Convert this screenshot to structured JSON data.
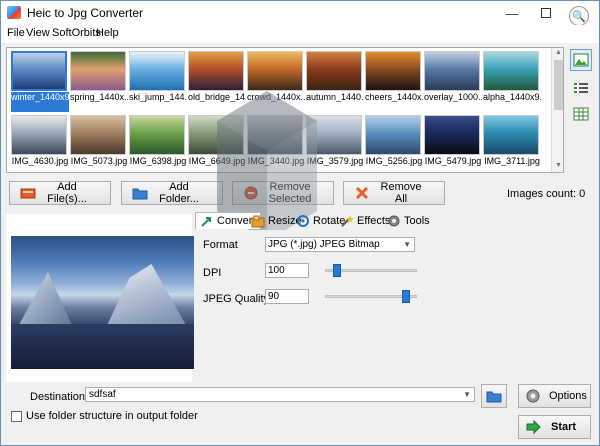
{
  "window": {
    "title": "Heic to Jpg Converter"
  },
  "menu": [
    "File",
    "View",
    "SoftOrbits",
    "Help"
  ],
  "thumbnails": [
    {
      "label": "winter_1440x960.heic",
      "selected": true,
      "colors": [
        "#1c3f78",
        "#5f8bc3",
        "#bcd0e6"
      ]
    },
    {
      "label": "spring_1440x...",
      "selected": false,
      "colors": [
        "#8d5a8e",
        "#e0a06a",
        "#3d6b3a"
      ]
    },
    {
      "label": "ski_jump_144...",
      "selected": false,
      "colors": [
        "#1d6fb3",
        "#6ab0e0",
        "#e8f2fa"
      ]
    },
    {
      "label": "old_bridge_14...",
      "selected": false,
      "colors": [
        "#2c1f3a",
        "#b24e2b",
        "#e0a040"
      ]
    },
    {
      "label": "crowd_1440x...",
      "selected": false,
      "colors": [
        "#3a2a1c",
        "#c06a28",
        "#f0b860"
      ]
    },
    {
      "label": "autumn_1440...",
      "selected": false,
      "colors": [
        "#3d2415",
        "#8a3a1c",
        "#d08040"
      ]
    },
    {
      "label": "cheers_1440x...",
      "selected": false,
      "colors": [
        "#1a1410",
        "#8a4a22",
        "#e0902a"
      ]
    },
    {
      "label": "overlay_1000...",
      "selected": false,
      "colors": [
        "#2a3a5a",
        "#5a7aa8",
        "#c0d0e0"
      ]
    },
    {
      "label": "alpha_1440x9...",
      "selected": false,
      "colors": [
        "#1f5a38",
        "#3aa0b8",
        "#a8d8e0"
      ]
    },
    {
      "label": "IMG_4630.jpg",
      "selected": false,
      "colors": [
        "#3a4a5a",
        "#9aa8b8",
        "#e8e8e8"
      ]
    },
    {
      "label": "IMG_5073.jpg",
      "selected": false,
      "colors": [
        "#4a3a2a",
        "#a08060",
        "#d8c0a0"
      ]
    },
    {
      "label": "IMG_6398.jpg",
      "selected": false,
      "colors": [
        "#2a5a2a",
        "#6aa04a",
        "#c8d8a0"
      ]
    },
    {
      "label": "IMG_6649.jpg",
      "selected": false,
      "colors": [
        "#3a4a3a",
        "#8a9a7a",
        "#d0d8c8"
      ]
    },
    {
      "label": "IMG_3440.jpg",
      "selected": false,
      "colors": [
        "#3a4a5a",
        "#808890",
        "#c8c8c8"
      ]
    },
    {
      "label": "IMG_3579.jpg",
      "selected": false,
      "colors": [
        "#4a5a6a",
        "#a0b0c0",
        "#d8e0e8"
      ]
    },
    {
      "label": "IMG_5256.jpg",
      "selected": false,
      "colors": [
        "#2a4a6a",
        "#5a90c0",
        "#b0d0e8"
      ]
    },
    {
      "label": "IMG_5479.jpg",
      "selected": false,
      "colors": [
        "#0a0a14",
        "#1a2a5a",
        "#3a4a8a"
      ]
    },
    {
      "label": "IMG_3711.jpg",
      "selected": false,
      "colors": [
        "#1a4a6a",
        "#2a8ab0",
        "#80c8e0"
      ]
    }
  ],
  "buttons": {
    "add_files": "Add File(s)...",
    "add_folder": "Add Folder...",
    "remove_selected": "Remove Selected",
    "remove_all": "Remove All",
    "options": "Options",
    "start": "Start"
  },
  "images_count": "Images count: 0",
  "tabs": [
    "Convert",
    "Resize",
    "Rotate",
    "Effects",
    "Tools"
  ],
  "settings": {
    "format_label": "Format",
    "format_value": "JPG (*.jpg) JPEG Bitmap",
    "dpi_label": "DPI",
    "dpi_value": "100",
    "quality_label": "JPEG Quality",
    "quality_value": "90",
    "dpi_slider_fraction": 0.08,
    "quality_slider_fraction": 0.9
  },
  "destination": {
    "label": "Destination",
    "value": "sdfsaf"
  },
  "use_folder_structure": "Use folder structure in output folder",
  "colors": {
    "accent": "#2d7bd6",
    "window_bg": "#f0f0f0"
  }
}
